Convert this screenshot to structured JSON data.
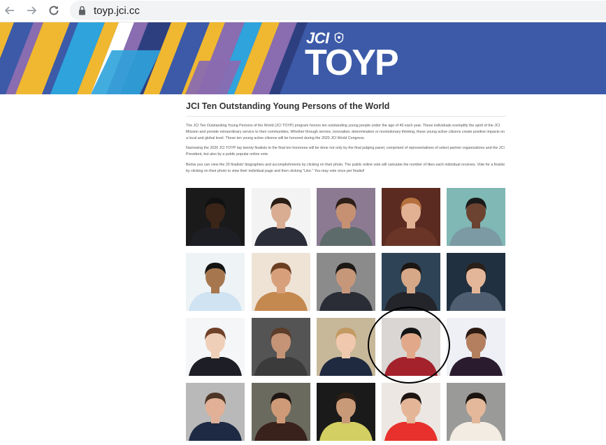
{
  "browser": {
    "url": "toyp.jci.cc"
  },
  "banner": {
    "logo_jci": "JCI",
    "logo_toyp": "TOYP"
  },
  "page": {
    "title": "JCI Ten Outstanding Young Persons of the World",
    "paragraphs": [
      "The JCI Ten Outstanding Young Persons of the World (JCI TOYP) program honors ten outstanding young people under the age of 40 each year. These individuals exemplify the spirit of the JCI Mission and provide extraordinary service to their communities. Whether through service, innovation, determination or revolutionary thinking, these young active citizens create positive impacts on a local and global level. These ten young active citizens will be honored during the 2020 JCI World Congress.",
      "Narrowing the 2020 JCI TOYP top twenty finalists to the final ten honorees will be done not only by the final judging panel, comprised of representatives of select partner organizations and the JCI President, but also by a public popular online vote.",
      "Below you can view the 20 finalists' biographies and accomplishments by clicking on their photo. The public online vote will calculate the number of likes each individual receives. Vote for a finalist by clicking on their photo to view their individual page and then clicking \"Like.\" You may vote once per finalist!"
    ]
  },
  "finalists": [
    {
      "bg": "#1a1a1a",
      "skin": "#3b2519",
      "hair": "#111111",
      "shirt": "#1d1d24"
    },
    {
      "bg": "#f3f3f3",
      "skin": "#d9ad92",
      "hair": "#2a1d15",
      "shirt": "#2b2e38"
    },
    {
      "bg": "#8c7a92",
      "skin": "#c69072",
      "hair": "#2d1f18",
      "shirt": "#5e6b6b"
    },
    {
      "bg": "#5b2b22",
      "skin": "#e2b193",
      "hair": "#b5703d",
      "shirt": "#6a3527"
    },
    {
      "bg": "#7fb8b4",
      "skin": "#6b4330",
      "hair": "#1a1a1a",
      "shirt": "#7b9aa3"
    },
    {
      "bg": "#eef3f5",
      "skin": "#a6774f",
      "hair": "#141414",
      "shirt": "#cfe3f2"
    },
    {
      "bg": "#efe3d6",
      "skin": "#d7a07b",
      "hair": "#6b3f22",
      "shirt": "#c4894e"
    },
    {
      "bg": "#8b8b8b",
      "skin": "#c7977a",
      "hair": "#1c1815",
      "shirt": "#2a2d36"
    },
    {
      "bg": "#2e4356",
      "skin": "#d6a888",
      "hair": "#1b1612",
      "shirt": "#23252b"
    },
    {
      "bg": "#213040",
      "skin": "#e3b699",
      "hair": "#2a1f19",
      "shirt": "#4f5f71"
    },
    {
      "bg": "#f4f6f8",
      "skin": "#efcfb8",
      "hair": "#6f4128",
      "shirt": "#1e1e26"
    },
    {
      "bg": "#545454",
      "skin": "#c59476",
      "hair": "#5b3d2a",
      "shirt": "#3b3b3b"
    },
    {
      "bg": "#c7b89a",
      "skin": "#efc8ad",
      "hair": "#c29a62",
      "shirt": "#1f2a40"
    },
    {
      "bg": "#d9d6d3",
      "skin": "#e1a98a",
      "hair": "#151515",
      "shirt": "#a4222c"
    },
    {
      "bg": "#eef0f6",
      "skin": "#b47f5f",
      "hair": "#2a1a12",
      "shirt": "#2a1c2e"
    },
    {
      "bg": "#b9b9b9",
      "skin": "#e1b097",
      "hair": "#4d3526",
      "shirt": "#1e2a44"
    },
    {
      "bg": "#6a6b5e",
      "skin": "#cf9a78",
      "hair": "#1e1612",
      "shirt": "#3a221c"
    },
    {
      "bg": "#1a1a1a",
      "skin": "#c99a78",
      "hair": "#2c1e15",
      "shirt": "#d3cf62"
    },
    {
      "bg": "#ece7e2",
      "skin": "#e4b597",
      "hair": "#1e1512",
      "shirt": "#e8312c"
    },
    {
      "bg": "#9a9a98",
      "skin": "#e3b89b",
      "hair": "#1b1410",
      "shirt": "#f2ece3"
    }
  ]
}
